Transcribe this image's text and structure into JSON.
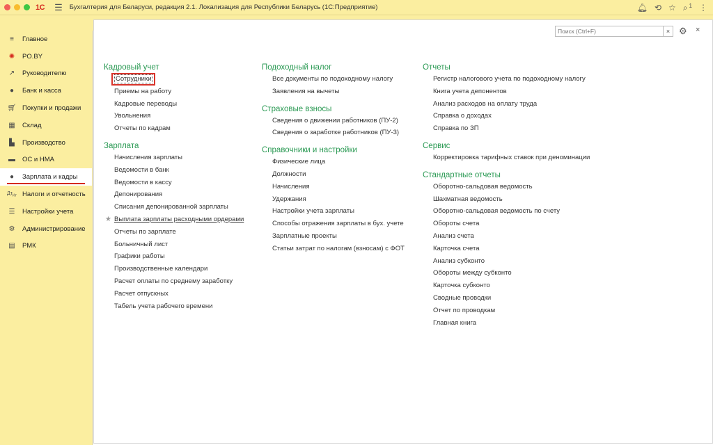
{
  "titlebar": {
    "logo": "1С",
    "title": "Бухгалтерия для Беларуси, редакция 2.1. Локализация для Республики Беларусь   (1С:Предприятие)",
    "notification_count": "1"
  },
  "sidebar": {
    "items": [
      {
        "label": "Главное",
        "icon": "menu-icon"
      },
      {
        "label": "PO.BY",
        "icon": "po-by-icon"
      },
      {
        "label": "Руководителю",
        "icon": "trend-icon"
      },
      {
        "label": "Банк и касса",
        "icon": "coin-icon"
      },
      {
        "label": "Покупки и продажи",
        "icon": "cart-icon"
      },
      {
        "label": "Склад",
        "icon": "warehouse-icon"
      },
      {
        "label": "Производство",
        "icon": "factory-icon"
      },
      {
        "label": "ОС и НМА",
        "icon": "assets-icon"
      },
      {
        "label": "Зарплата и кадры",
        "icon": "person-icon"
      },
      {
        "label": "Налоги и отчетность",
        "icon": "tax-icon"
      },
      {
        "label": "Настройки учета",
        "icon": "settings-list-icon"
      },
      {
        "label": "Администрирование",
        "icon": "gear-icon"
      },
      {
        "label": "РМК",
        "icon": "pos-icon"
      }
    ],
    "active_index": 8
  },
  "search": {
    "placeholder": "Поиск (Ctrl+F)",
    "clear": "×"
  },
  "close_label": "×",
  "columns": {
    "col1": {
      "kadr": {
        "title": "Кадровый учет",
        "items": [
          "Сотрудники",
          "Приемы на работу",
          "Кадровые переводы",
          "Увольнения",
          "Отчеты по кадрам"
        ]
      },
      "zarplata": {
        "title": "Зарплата",
        "items": [
          "Начисления зарплаты",
          "Ведомости в банк",
          "Ведомости в кассу",
          "Депонирования",
          "Списания депонированной зарплаты",
          "Выплата зарплаты расходными ордерами",
          "Отчеты по зарплате",
          "Больничный лист",
          "Графики работы",
          "Производственные календари",
          "Расчет оплаты по среднему заработку",
          "Расчет отпускных",
          "Табель учета рабочего времени"
        ]
      }
    },
    "col2": {
      "podoh": {
        "title": "Подоходный налог",
        "items": [
          "Все документы по подоходному налогу",
          "Заявления на вычеты"
        ]
      },
      "strah": {
        "title": "Страховые взносы",
        "items": [
          "Сведения о движении работников (ПУ-2)",
          "Сведения о заработке работников (ПУ-3)"
        ]
      },
      "sprav": {
        "title": "Справочники и настройки",
        "items": [
          "Физические лица",
          "Должности",
          "Начисления",
          "Удержания",
          "Настройки учета зарплаты",
          "Способы отражения зарплаты в бух. учете",
          "Зарплатные проекты",
          "Статьи затрат по налогам (взносам) с ФОТ"
        ]
      }
    },
    "col3": {
      "otchety": {
        "title": "Отчеты",
        "items": [
          "Регистр налогового учета по подоходному налогу",
          "Книга учета депонентов",
          "Анализ расходов на оплату труда",
          "Справка о доходах",
          "Справка по ЗП"
        ]
      },
      "servis": {
        "title": "Сервис",
        "items": [
          "Корректировка тарифных ставок при деноминации"
        ]
      },
      "std": {
        "title": "Стандартные отчеты",
        "items": [
          "Оборотно-сальдовая ведомость",
          "Шахматная ведомость",
          "Оборотно-сальдовая ведомость по счету",
          "Обороты счета",
          "Анализ счета",
          "Карточка счета",
          "Анализ субконто",
          "Обороты между субконто",
          "Карточка субконто",
          "Сводные проводки",
          "Отчет по проводкам",
          "Главная книга"
        ]
      }
    }
  }
}
